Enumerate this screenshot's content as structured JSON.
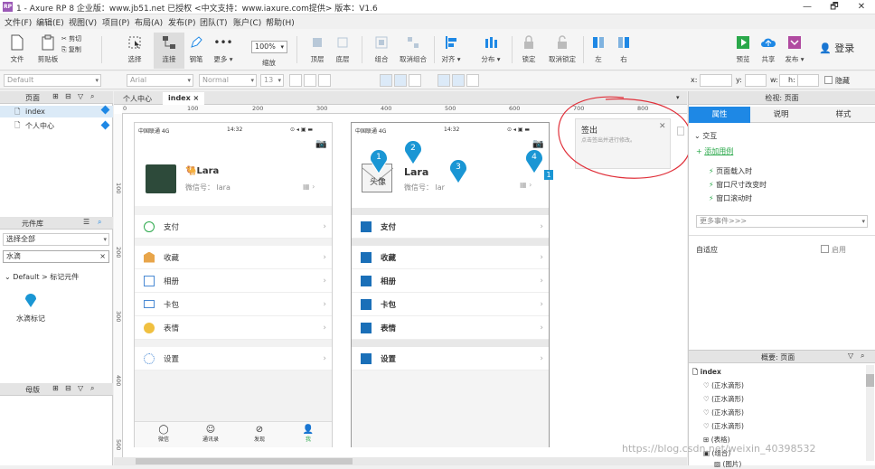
{
  "window": {
    "title": "1 - Axure RP 8 企业版：www.jb51.net 已授权    <中文支持：www.iaxure.com提供> 版本：V1.6",
    "app_icon": "RP",
    "min": "—",
    "max": "🗗",
    "close": "✕"
  },
  "menu": [
    "文件(F)",
    "编辑(E)",
    "视图(V)",
    "项目(P)",
    "布局(A)",
    "发布(P)",
    "团队(T)",
    "账户(C)",
    "帮助(H)"
  ],
  "toolbar": {
    "file": "文件",
    "clipboard": "剪贴板",
    "cut": "✂ 剪切",
    "copy": "⎘ 复制",
    "select": "选择",
    "connect": "连接",
    "pen": "钢笔",
    "more": "更多 ▾",
    "zoom_value": "100%",
    "zoom_label": "缩放",
    "top": "顶层",
    "bottom": "底层",
    "group": "组合",
    "ungroup": "取消组合",
    "align": "对齐 ▾",
    "distribute": "分布 ▾",
    "lock": "锁定",
    "unlock": "取消锁定",
    "left": "左",
    "right": "右",
    "preview": "预览",
    "share": "共享",
    "publish": "发布 ▾",
    "login": "登录"
  },
  "format": {
    "style": "Default",
    "font": "Arial",
    "weight": "Normal",
    "size": "13",
    "x": "x:",
    "y": "y:",
    "w": "w:",
    "h": "h:",
    "hide": "隐藏"
  },
  "pages_panel": {
    "title": "页面",
    "items": [
      "index",
      "个人中心"
    ]
  },
  "library_panel": {
    "title": "元件库",
    "select": "选择全部",
    "search": "水滴",
    "group": "Default > 标记元件",
    "widget": "水滴标记"
  },
  "masters_panel": {
    "title": "母版"
  },
  "tabs": {
    "tab1": "个人中心",
    "tab2": "index",
    "close": "×"
  },
  "ruler_h": [
    "0",
    "100",
    "200",
    "300",
    "400",
    "500",
    "600",
    "700",
    "800"
  ],
  "ruler_v": [
    "100",
    "200",
    "300",
    "400",
    "500"
  ],
  "left_phone": {
    "carrier": "中国联通  4G",
    "time": "14:32",
    "name": "Lara",
    "wechat": "微信号： lara",
    "menu": [
      "支付",
      "收藏",
      "相册",
      "卡包",
      "表情",
      "设置"
    ],
    "bottom_nav": [
      "微信",
      "通讯录",
      "发现",
      "我"
    ]
  },
  "right_phone": {
    "carrier": "中国联通  4G",
    "time": "14:32",
    "avatar": "头像",
    "name": "Lara",
    "wechat": "微信号： lar",
    "menu": [
      "支付",
      "收藏",
      "相册",
      "卡包",
      "表情",
      "设置"
    ],
    "markers": [
      "1",
      "2",
      "3",
      "4"
    ]
  },
  "badge": "1",
  "signout": {
    "title": "签出",
    "desc": "点击签出并进行修改。",
    "close": "✕"
  },
  "watermark": "https://blog.csdn.net/weixin_40398532",
  "inspector": {
    "title": "检视: 页面",
    "tabs": [
      "属性",
      "说明",
      "样式"
    ],
    "interaction": "交互",
    "add_case": "添加用例",
    "events": [
      "页面载入时",
      "窗口尺寸改变时",
      "窗口滚动时"
    ],
    "more_events": "更多事件>>>",
    "adaptive": "自适应",
    "enable": "启用"
  },
  "outline": {
    "title": "概要: 页面",
    "root": "index",
    "items": [
      "(正水滴形)",
      "(正水滴形)",
      "(正水滴形)",
      "(正水滴形)",
      "(表格)",
      "(组合)",
      "(图片)"
    ]
  },
  "colors": {
    "accent": "#0a88d8",
    "marker": "#1a96d4",
    "active_tab": "#1e88e5",
    "title_purple": "#9b59b6",
    "annotation": "#e0303a"
  }
}
